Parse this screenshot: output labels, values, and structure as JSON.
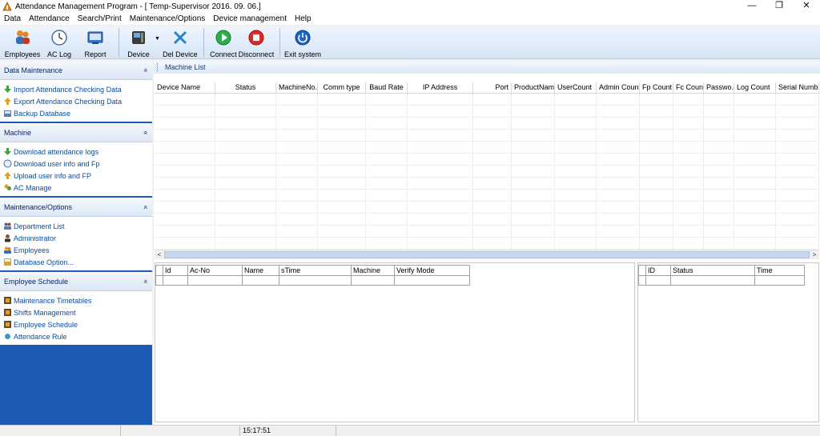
{
  "window": {
    "title": "Attendance Management Program - [ Temp-Supervisor 2016. 09. 06.]",
    "controls": [
      "—",
      "❐",
      "✕"
    ]
  },
  "menu": [
    "Data",
    "Attendance",
    "Search/Print",
    "Maintenance/Options",
    "Device management",
    "Help"
  ],
  "toolbar": {
    "employees": "Employees",
    "ac_log": "AC Log",
    "report": "Report",
    "device": "Device",
    "dropdown_arrow": "▼",
    "del_device": "Del Device",
    "connect": "Connect",
    "disconnect": "Disconnect",
    "exit": "Exit system"
  },
  "sidebar": {
    "chevron": "«",
    "groups": [
      {
        "title": "Data Maintenance",
        "items": [
          "Import Attendance Checking Data",
          "Export Attendance Checking Data",
          "Backup Database"
        ]
      },
      {
        "title": "Machine",
        "items": [
          "Download attendance logs",
          "Download user info and Fp",
          "Upload user info and FP",
          "AC Manage"
        ]
      },
      {
        "title": "Maintenance/Options",
        "items": [
          "Department List",
          "Administrator",
          "Employees",
          "Database Option..."
        ]
      },
      {
        "title": "Employee Schedule",
        "items": [
          "Maintenance Timetables",
          "Shifts Management",
          "Employee Schedule",
          "Attendance Rule"
        ]
      }
    ]
  },
  "machine_list": {
    "title": "Machine List",
    "columns": [
      "Device Name",
      "Status",
      "MachineNo.",
      "Comm type",
      "Baud Rate",
      "IP Address",
      "Port",
      "ProductName",
      "UserCount",
      "Admin Count",
      "Fp Count",
      "Fc Count",
      "Passwo...",
      "Log Count",
      "Serial Number"
    ]
  },
  "scroll": {
    "left": "<",
    "right": ">"
  },
  "log_grid": {
    "columns": [
      "Id",
      "Ac-No",
      "Name",
      "sTime",
      "Machine",
      "Verify Mode"
    ]
  },
  "status_grid": {
    "columns": [
      "ID",
      "Status",
      "Time"
    ]
  },
  "statusbar": {
    "time": "15:17:51"
  }
}
